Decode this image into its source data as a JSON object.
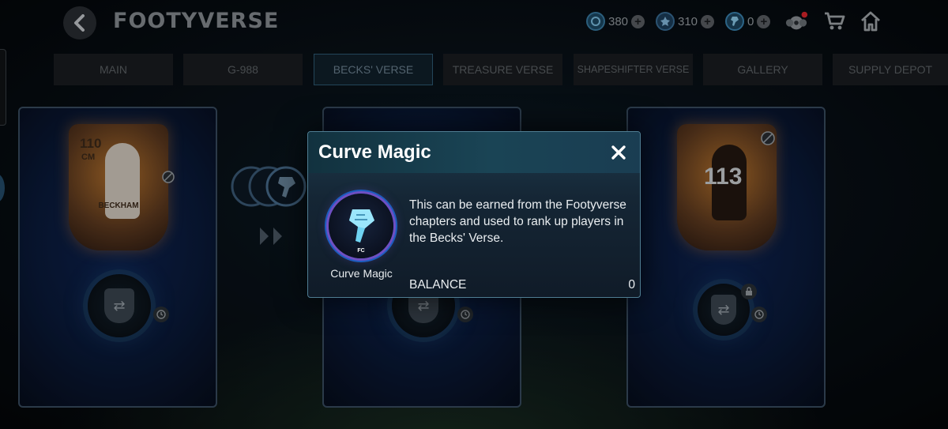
{
  "header": {
    "title": "FOOTYVERSE",
    "currencies": [
      {
        "icon": "coin-icon",
        "value": "380"
      },
      {
        "icon": "points-icon",
        "value": "310"
      },
      {
        "icon": "curve-magic-icon",
        "value": "0"
      }
    ]
  },
  "tabs": [
    {
      "label": "MAIN"
    },
    {
      "label": "G-988"
    },
    {
      "label": "BECKS' VERSE"
    },
    {
      "label": "TREASURE VERSE"
    },
    {
      "label": "SHAPESHIFTER VERSE"
    },
    {
      "label": "GALLERY"
    },
    {
      "label": "SUPPLY DEPOT"
    }
  ],
  "cards": [
    {
      "rating": "110",
      "position": "CM",
      "name": "BECKHAM"
    },
    {
      "rating": "113"
    }
  ],
  "modal": {
    "title": "Curve Magic",
    "item_label": "Curve Magic",
    "description": "This can be earned from the Footyverse chapters and used to rank up players in the Becks' Verse.",
    "balance_label": "BALANCE",
    "balance_value": "0"
  },
  "colors": {
    "active_tab_border": "#2f5d77",
    "modal_border": "#4f7d92",
    "notification_dot": "#e0262c"
  }
}
